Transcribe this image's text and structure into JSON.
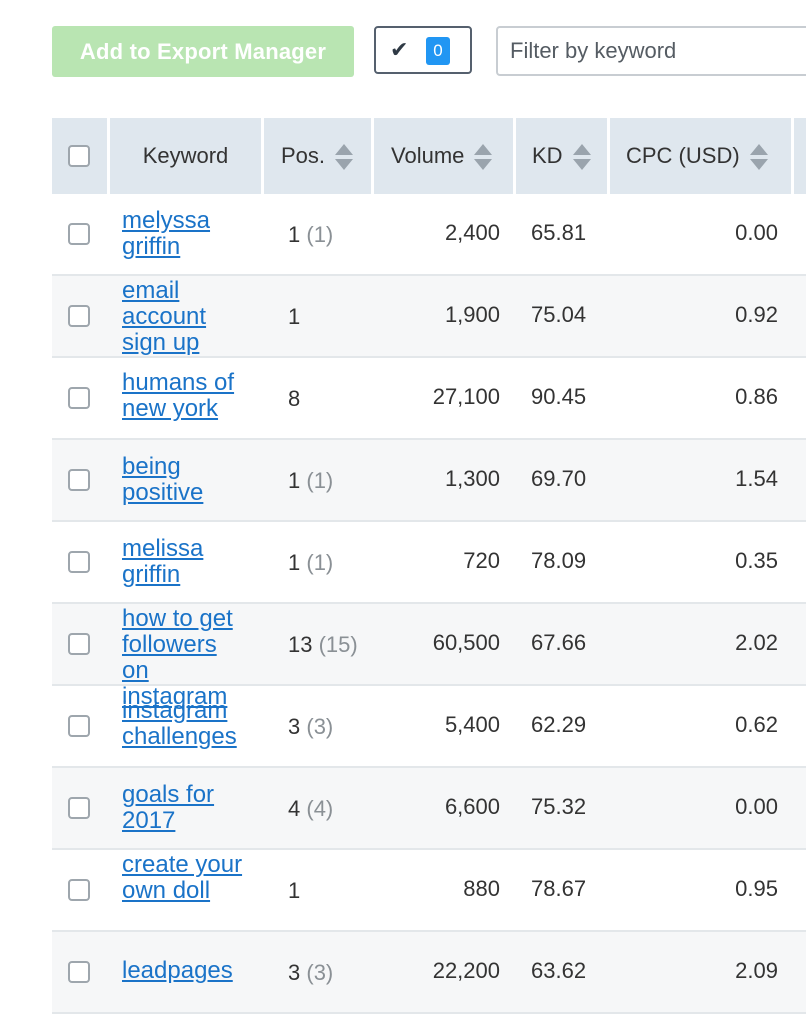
{
  "toolbar": {
    "export_label": "Add to Export Manager",
    "checked_count": "0",
    "filter_placeholder": "Filter by keyword"
  },
  "table": {
    "columns": {
      "keyword": "Keyword",
      "pos": "Pos.",
      "volume": "Volume",
      "kd": "KD",
      "cpc": "CPC (USD)"
    },
    "rows": [
      {
        "keyword": "melyssa griffin",
        "pos": "1",
        "pos_prev": "(1)",
        "volume": "2,400",
        "kd": "65.81",
        "cpc": "0.00"
      },
      {
        "keyword": "email account sign up",
        "pos": "1",
        "pos_prev": "",
        "volume": "1,900",
        "kd": "75.04",
        "cpc": "0.92"
      },
      {
        "keyword": "humans of new york",
        "pos": "8",
        "pos_prev": "",
        "volume": "27,100",
        "kd": "90.45",
        "cpc": "0.86"
      },
      {
        "keyword": "being positive",
        "pos": "1",
        "pos_prev": "(1)",
        "volume": "1,300",
        "kd": "69.70",
        "cpc": "1.54"
      },
      {
        "keyword": "melissa griffin",
        "pos": "1",
        "pos_prev": "(1)",
        "volume": "720",
        "kd": "78.09",
        "cpc": "0.35"
      },
      {
        "keyword": "how to get followers on instagram",
        "pos": "13",
        "pos_prev": "(15)",
        "volume": "60,500",
        "kd": "67.66",
        "cpc": "2.02"
      },
      {
        "keyword": "instagram challenges",
        "pos": "3",
        "pos_prev": "(3)",
        "volume": "5,400",
        "kd": "62.29",
        "cpc": "0.62"
      },
      {
        "keyword": "goals for 2017",
        "pos": "4",
        "pos_prev": "(4)",
        "volume": "6,600",
        "kd": "75.32",
        "cpc": "0.00"
      },
      {
        "keyword": "create your own doll",
        "pos": "1",
        "pos_prev": "",
        "volume": "880",
        "kd": "78.67",
        "cpc": "0.95"
      },
      {
        "keyword": "leadpages",
        "pos": "3",
        "pos_prev": "(3)",
        "volume": "22,200",
        "kd": "63.62",
        "cpc": "2.09"
      }
    ]
  }
}
